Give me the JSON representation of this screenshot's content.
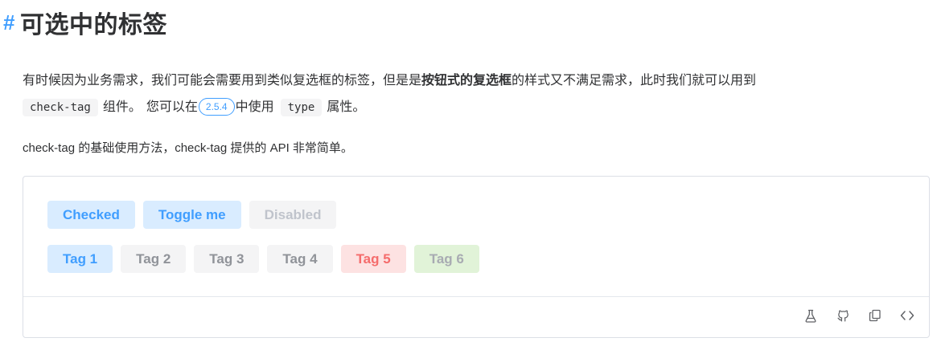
{
  "heading": {
    "hash": "#",
    "title": "可选中的标签"
  },
  "intro": {
    "line1_a": "有时候因为业务需求，我们可能会需要用到类似复选框的标签，但是是",
    "line1_bold": "按钮式的复选框",
    "line1_b": "的样式又不满足需求，此时我们就可以用到",
    "code_check_tag": "check-tag",
    "line2_a": "组件。",
    "line2_b": "您可以在",
    "version": "2.5.4",
    "line2_c": "中使用",
    "code_type": "type",
    "line2_d": "属性。"
  },
  "description": "check-tag 的基础使用方法，check-tag 提供的 API 非常简单。",
  "demo": {
    "row1": [
      {
        "label": "Checked",
        "state": "checked"
      },
      {
        "label": "Toggle me",
        "state": "checked"
      },
      {
        "label": "Disabled",
        "state": "disabled"
      }
    ],
    "row2": [
      {
        "label": "Tag 1",
        "type": "primary",
        "checked": true
      },
      {
        "label": "Tag 2",
        "type": "default"
      },
      {
        "label": "Tag 3",
        "type": "default"
      },
      {
        "label": "Tag 4",
        "type": "default"
      },
      {
        "label": "Tag 5",
        "type": "danger",
        "checked": true
      },
      {
        "label": "Tag 6",
        "type": "success",
        "checked": true
      }
    ],
    "footer_icons": [
      "playground-icon",
      "github-icon",
      "copy-icon",
      "code-icon"
    ]
  },
  "colors": {
    "primary": "#409eff",
    "primary_light": "#d9ecff",
    "neutral_bg": "#f4f4f5",
    "neutral_text": "#909399",
    "danger_bg": "#fde2e2",
    "danger_text": "#f56c6c",
    "success_bg": "#e1f3d8",
    "border": "#dcdfe6"
  }
}
